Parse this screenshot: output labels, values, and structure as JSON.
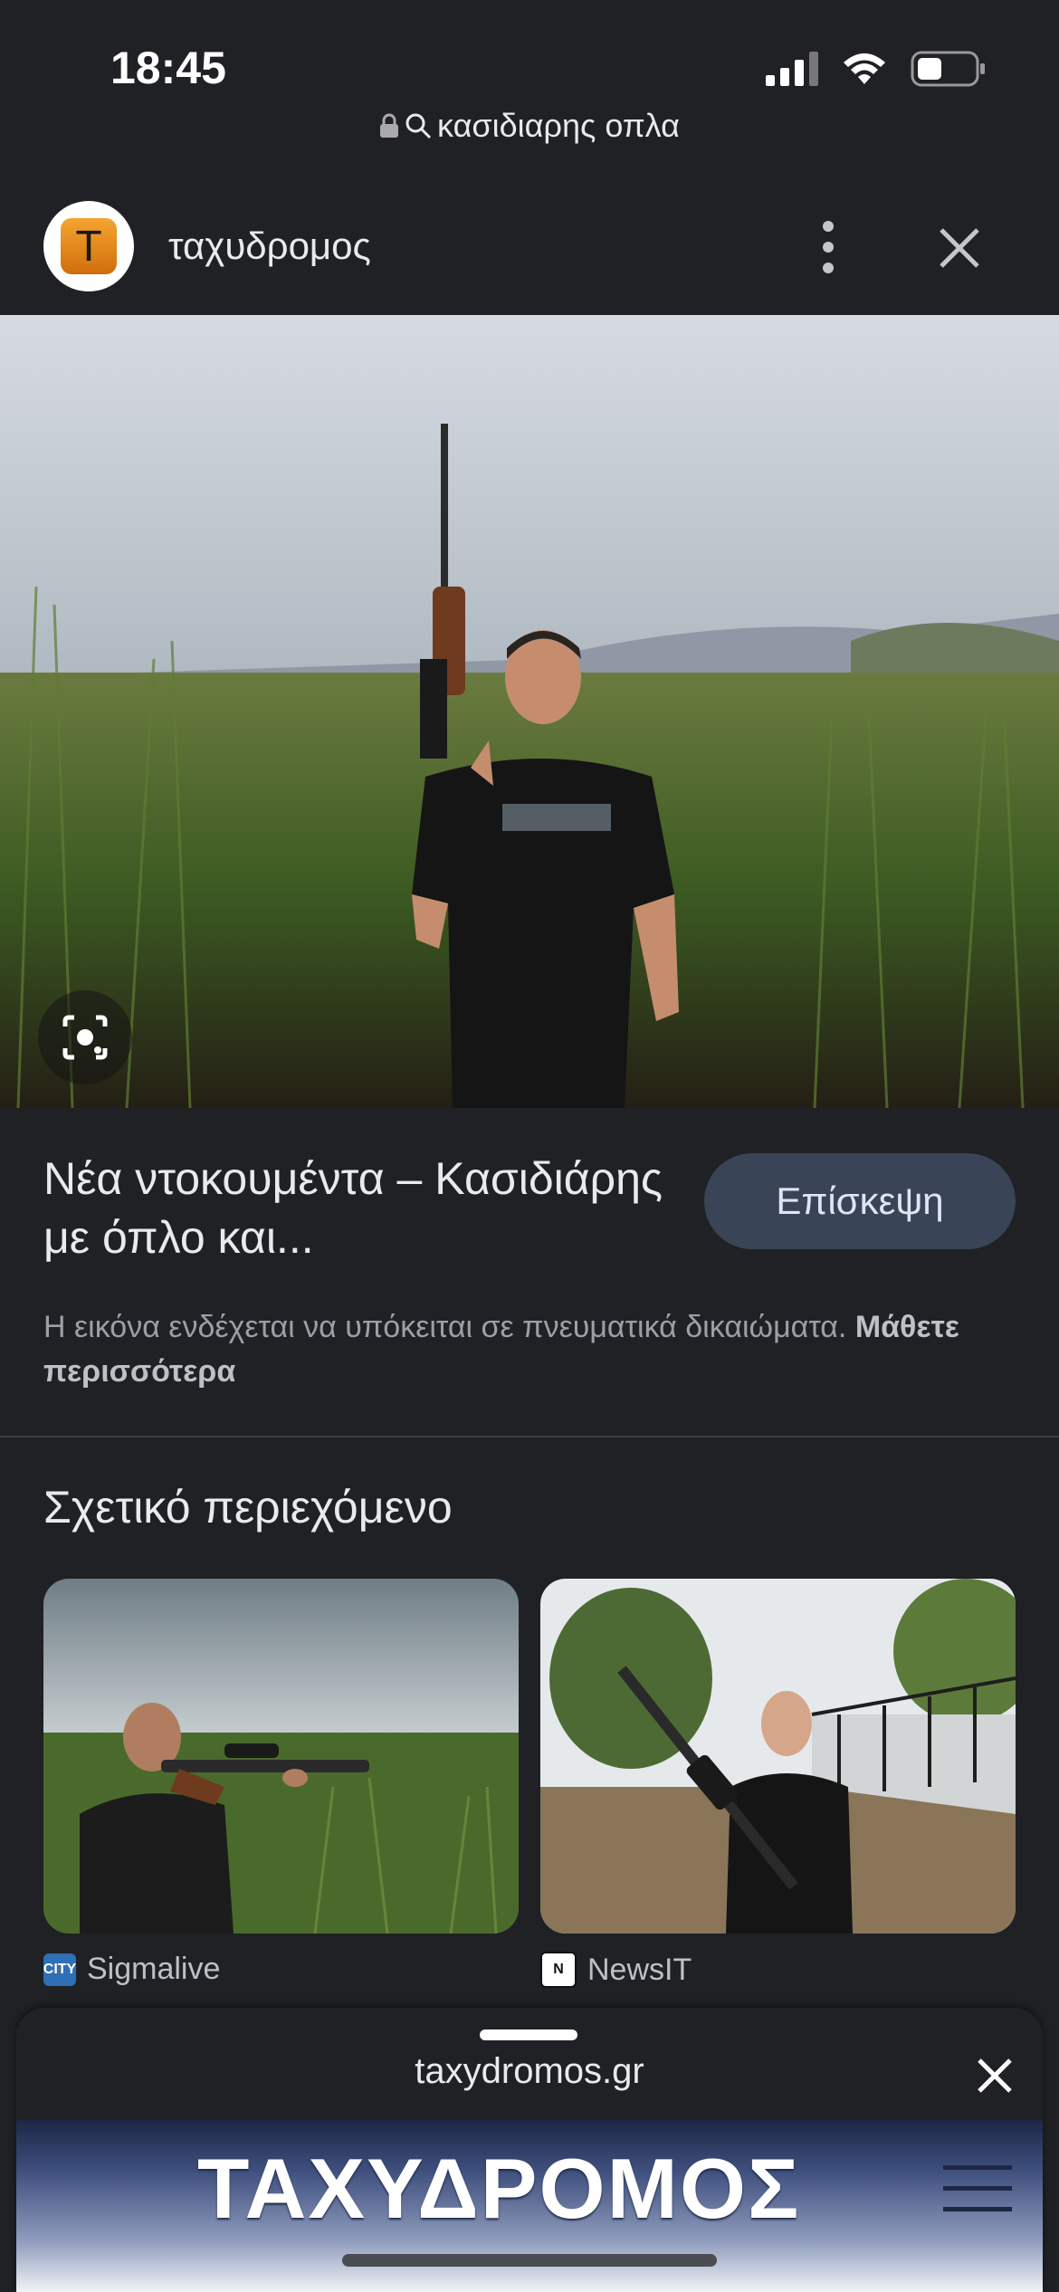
{
  "status": {
    "time": "18:45"
  },
  "browser": {
    "url_text": "κασιδιαρης οπλα"
  },
  "site": {
    "name": "ταχυδρομος",
    "avatar_letter": "T"
  },
  "result": {
    "title": "Νέα ντοκουμέντα – Κασιδιάρης με όπλο και...",
    "visit_label": "Επίσκεψη",
    "copyright_text": "Η εικόνα ενδέχεται να υπόκειται σε πνευματικά δικαιώματα.",
    "learn_more": "Μάθετε περισσότερα"
  },
  "related": {
    "title": "Σχετικό περιεχόμενο",
    "items": [
      {
        "source": "Sigmalive",
        "icon_text": "CITY"
      },
      {
        "source": "NewsIT",
        "icon_text": "N"
      }
    ]
  },
  "sheet": {
    "url": "taxydromos.gr",
    "banner_title": "ΤΑΧΥΔΡΟΜΟΣ"
  },
  "colors": {
    "background": "#202124",
    "visit_button": "#394457",
    "text_secondary": "#9aa0a6"
  },
  "icons": [
    "signal-icon",
    "wifi-icon",
    "battery-icon",
    "lock-icon",
    "search-icon",
    "more-vert-icon",
    "close-icon",
    "lens-icon",
    "menu-icon"
  ]
}
